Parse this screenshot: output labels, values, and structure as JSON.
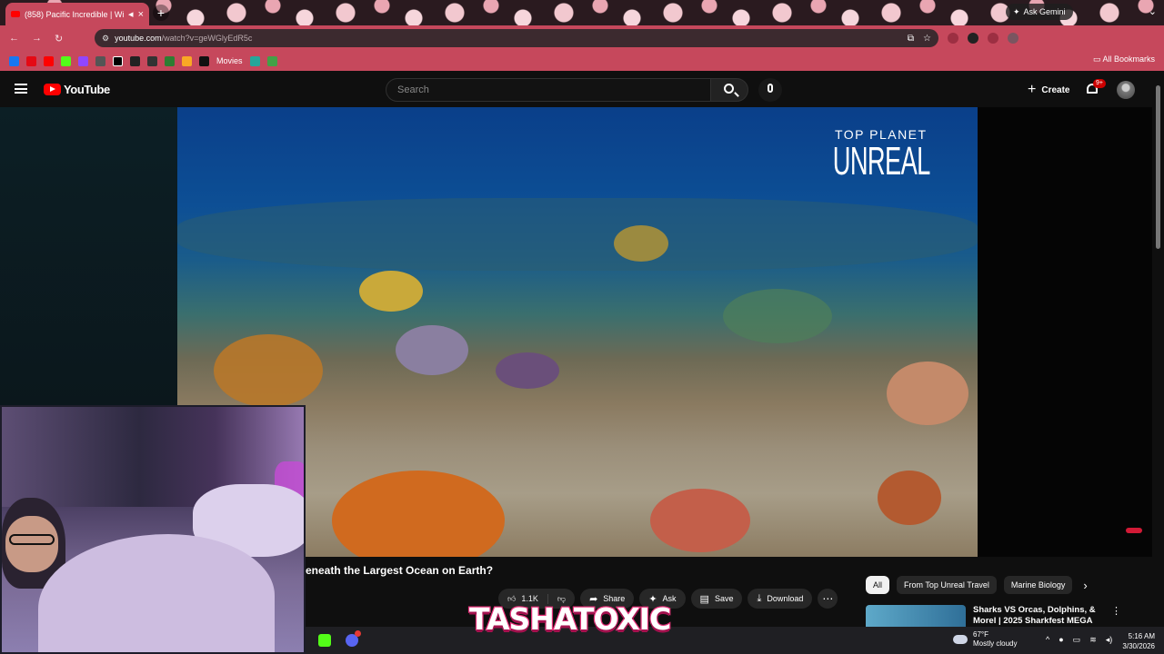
{
  "browser": {
    "tab_title": "(858) Pacific Incredible | Wi",
    "url_host": "youtube.com",
    "url_path": "/watch?v=geWGlyEdR5c",
    "ask_gemini": "Ask Gemini",
    "bookmarks": [
      "Movies"
    ],
    "all_bookmarks": "All Bookmarks",
    "theme_color": "#c6485c"
  },
  "youtube": {
    "logo_text": "YouTube",
    "search_placeholder": "Search",
    "create_label": "Create",
    "notifications_badge": "9+"
  },
  "video": {
    "brand_top": "TOP PLANET",
    "brand_main": "UNREAL",
    "title": "eneath the Largest Ocean on Earth?",
    "like_count": "1.1K",
    "actions": {
      "share": "Share",
      "ask": "Ask",
      "save": "Save",
      "download": "Download"
    }
  },
  "sidebar_chips": [
    "All",
    "From Top Unreal Travel",
    "Marine Biology"
  ],
  "recommendation": {
    "title": "Sharks VS Orcas, Dolphins, & Morel | 2025 Sharkfest MEGA"
  },
  "overlay": {
    "streamer_name": "TASHATOXIC"
  },
  "taskbar": {
    "temperature": "67°F",
    "weather": "Mostly cloudy",
    "time": "5:16 AM",
    "date": "3/30/2026"
  }
}
